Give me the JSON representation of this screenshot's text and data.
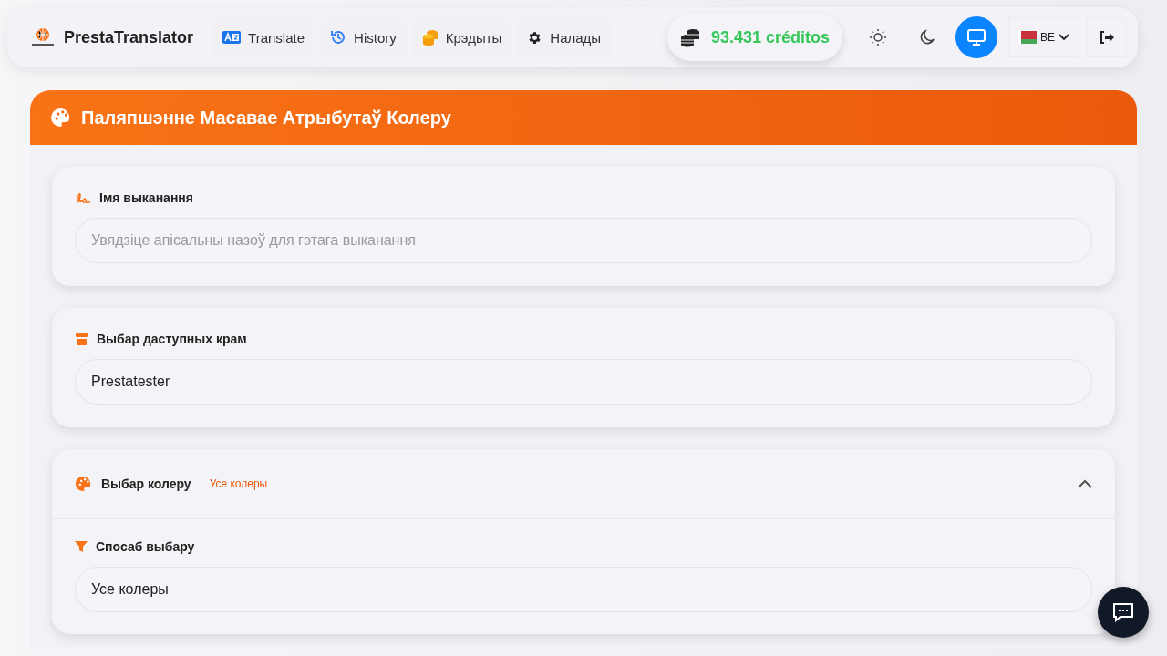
{
  "brand": "PrestaTranslator",
  "nav": [
    {
      "label": "Translate"
    },
    {
      "label": "History"
    },
    {
      "label": "Крэдыты"
    },
    {
      "label": "Налады"
    }
  ],
  "credits": "93.431 créditos",
  "theme_buttons": [
    {
      "selected": false
    },
    {
      "selected": false
    },
    {
      "selected": true
    }
  ],
  "language": "BE",
  "panel": {
    "title": "Паляпшэнне Масавае Атрыбутаў Колеру",
    "sections": [
      {
        "kind": "field",
        "label": "Імя выканання",
        "placeholder": "Увядзіце апісальны назоў для гэтага выканання"
      },
      {
        "kind": "field",
        "label": "Выбар даступных крам",
        "value": "Prestatester"
      },
      {
        "kind": "collapsible",
        "label": "Выбар колеру",
        "badge": "Усе колеры",
        "expanded": true,
        "sublabel": "Спосаб выбару",
        "value": "Усе колеры"
      }
    ]
  }
}
